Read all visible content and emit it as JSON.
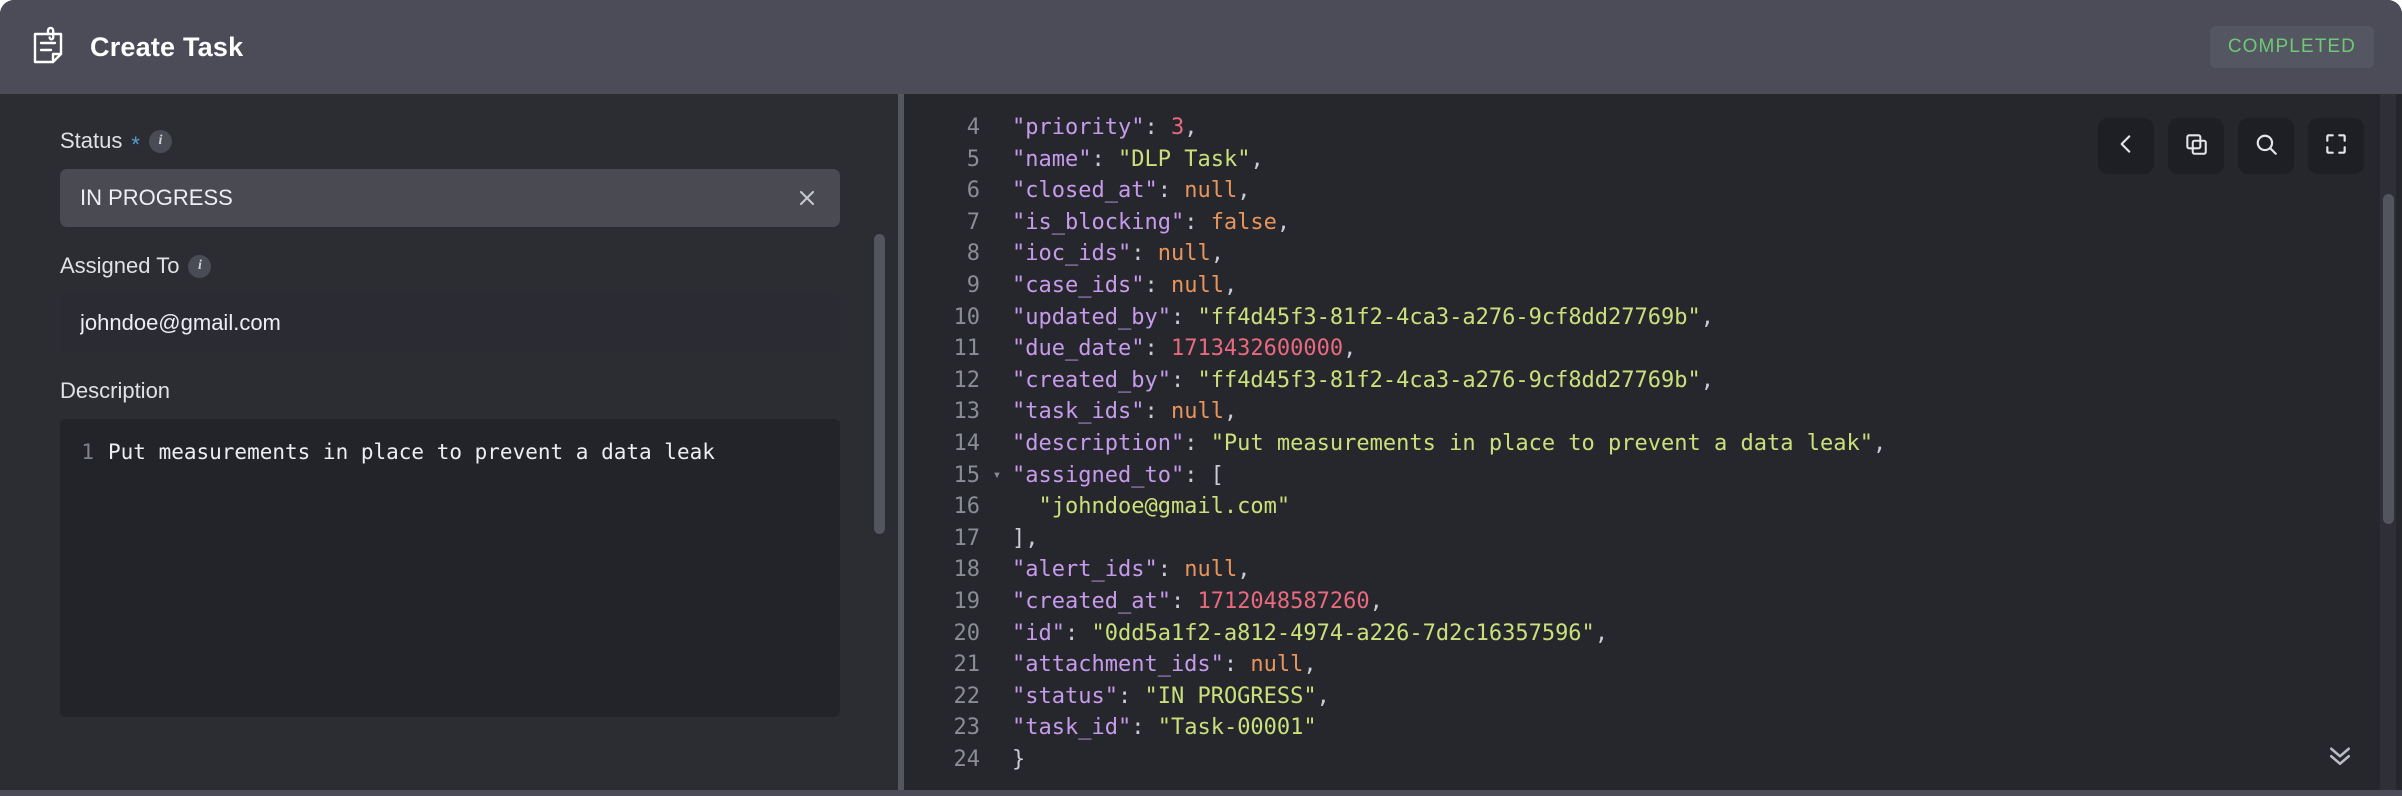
{
  "header": {
    "icon": "task-note-icon",
    "title": "Create Task",
    "status_badge": "COMPLETED",
    "badge_color": "#6ec877",
    "background": "#4b4c57"
  },
  "form": {
    "status_field": {
      "label": "Status",
      "required_marker": "*",
      "info_icon": "i",
      "value": "IN PROGRESS",
      "clear_icon": "✕"
    },
    "assigned_field": {
      "label": "Assigned To",
      "info_icon": "i",
      "value": "johndoe@gmail.com"
    },
    "description_field": {
      "label": "Description",
      "line_number": "1",
      "value": "Put measurements in place to prevent a data leak"
    }
  },
  "code_panel": {
    "toolbar": [
      {
        "name": "back-button",
        "icon": "chevron-left-icon"
      },
      {
        "name": "copy-button",
        "icon": "copy-icon"
      },
      {
        "name": "search-button",
        "icon": "search-icon"
      },
      {
        "name": "fullscreen-button",
        "icon": "fullscreen-icon"
      }
    ],
    "scroll_bottom_icon": "chevron-double-down-icon",
    "lines": [
      {
        "n": "4",
        "fold": "",
        "tokens": [
          {
            "t": "\"priority\"",
            "c": "tk-key"
          },
          {
            "t": ": ",
            "c": "tk-pun"
          },
          {
            "t": "3",
            "c": "tk-num"
          },
          {
            "t": ",",
            "c": "tk-pun"
          }
        ]
      },
      {
        "n": "5",
        "fold": "",
        "tokens": [
          {
            "t": "\"name\"",
            "c": "tk-key"
          },
          {
            "t": ": ",
            "c": "tk-pun"
          },
          {
            "t": "\"DLP Task\"",
            "c": "tk-str"
          },
          {
            "t": ",",
            "c": "tk-pun"
          }
        ]
      },
      {
        "n": "6",
        "fold": "",
        "tokens": [
          {
            "t": "\"closed_at\"",
            "c": "tk-key"
          },
          {
            "t": ": ",
            "c": "tk-pun"
          },
          {
            "t": "null",
            "c": "tk-lit"
          },
          {
            "t": ",",
            "c": "tk-pun"
          }
        ]
      },
      {
        "n": "7",
        "fold": "",
        "tokens": [
          {
            "t": "\"is_blocking\"",
            "c": "tk-key"
          },
          {
            "t": ": ",
            "c": "tk-pun"
          },
          {
            "t": "false",
            "c": "tk-lit"
          },
          {
            "t": ",",
            "c": "tk-pun"
          }
        ]
      },
      {
        "n": "8",
        "fold": "",
        "tokens": [
          {
            "t": "\"ioc_ids\"",
            "c": "tk-key"
          },
          {
            "t": ": ",
            "c": "tk-pun"
          },
          {
            "t": "null",
            "c": "tk-lit"
          },
          {
            "t": ",",
            "c": "tk-pun"
          }
        ]
      },
      {
        "n": "9",
        "fold": "",
        "tokens": [
          {
            "t": "\"case_ids\"",
            "c": "tk-key"
          },
          {
            "t": ": ",
            "c": "tk-pun"
          },
          {
            "t": "null",
            "c": "tk-lit"
          },
          {
            "t": ",",
            "c": "tk-pun"
          }
        ]
      },
      {
        "n": "10",
        "fold": "",
        "tokens": [
          {
            "t": "\"updated_by\"",
            "c": "tk-key"
          },
          {
            "t": ": ",
            "c": "tk-pun"
          },
          {
            "t": "\"ff4d45f3-81f2-4ca3-a276-9cf8dd27769b\"",
            "c": "tk-str"
          },
          {
            "t": ",",
            "c": "tk-pun"
          }
        ]
      },
      {
        "n": "11",
        "fold": "",
        "tokens": [
          {
            "t": "\"due_date\"",
            "c": "tk-key"
          },
          {
            "t": ": ",
            "c": "tk-pun"
          },
          {
            "t": "1713432600000",
            "c": "tk-num"
          },
          {
            "t": ",",
            "c": "tk-pun"
          }
        ]
      },
      {
        "n": "12",
        "fold": "",
        "tokens": [
          {
            "t": "\"created_by\"",
            "c": "tk-key"
          },
          {
            "t": ": ",
            "c": "tk-pun"
          },
          {
            "t": "\"ff4d45f3-81f2-4ca3-a276-9cf8dd27769b\"",
            "c": "tk-str"
          },
          {
            "t": ",",
            "c": "tk-pun"
          }
        ]
      },
      {
        "n": "13",
        "fold": "",
        "tokens": [
          {
            "t": "\"task_ids\"",
            "c": "tk-key"
          },
          {
            "t": ": ",
            "c": "tk-pun"
          },
          {
            "t": "null",
            "c": "tk-lit"
          },
          {
            "t": ",",
            "c": "tk-pun"
          }
        ]
      },
      {
        "n": "14",
        "fold": "",
        "tokens": [
          {
            "t": "\"description\"",
            "c": "tk-key"
          },
          {
            "t": ": ",
            "c": "tk-pun"
          },
          {
            "t": "\"Put measurements in place to prevent a data leak\"",
            "c": "tk-str"
          },
          {
            "t": ",",
            "c": "tk-pun"
          }
        ]
      },
      {
        "n": "15",
        "fold": "▾",
        "tokens": [
          {
            "t": "\"assigned_to\"",
            "c": "tk-key"
          },
          {
            "t": ": [",
            "c": "tk-pun"
          }
        ]
      },
      {
        "n": "16",
        "fold": "",
        "tokens": [
          {
            "t": "  \"johndoe@gmail.com\"",
            "c": "tk-str"
          }
        ]
      },
      {
        "n": "17",
        "fold": "",
        "tokens": [
          {
            "t": "],",
            "c": "tk-pun"
          }
        ]
      },
      {
        "n": "18",
        "fold": "",
        "tokens": [
          {
            "t": "\"alert_ids\"",
            "c": "tk-key"
          },
          {
            "t": ": ",
            "c": "tk-pun"
          },
          {
            "t": "null",
            "c": "tk-lit"
          },
          {
            "t": ",",
            "c": "tk-pun"
          }
        ]
      },
      {
        "n": "19",
        "fold": "",
        "tokens": [
          {
            "t": "\"created_at\"",
            "c": "tk-key"
          },
          {
            "t": ": ",
            "c": "tk-pun"
          },
          {
            "t": "1712048587260",
            "c": "tk-num"
          },
          {
            "t": ",",
            "c": "tk-pun"
          }
        ]
      },
      {
        "n": "20",
        "fold": "",
        "tokens": [
          {
            "t": "\"id\"",
            "c": "tk-key"
          },
          {
            "t": ": ",
            "c": "tk-pun"
          },
          {
            "t": "\"0dd5a1f2-a812-4974-a226-7d2c16357596\"",
            "c": "tk-str"
          },
          {
            "t": ",",
            "c": "tk-pun"
          }
        ]
      },
      {
        "n": "21",
        "fold": "",
        "tokens": [
          {
            "t": "\"attachment_ids\"",
            "c": "tk-key"
          },
          {
            "t": ": ",
            "c": "tk-pun"
          },
          {
            "t": "null",
            "c": "tk-lit"
          },
          {
            "t": ",",
            "c": "tk-pun"
          }
        ]
      },
      {
        "n": "22",
        "fold": "",
        "tokens": [
          {
            "t": "\"status\"",
            "c": "tk-key"
          },
          {
            "t": ": ",
            "c": "tk-pun"
          },
          {
            "t": "\"IN PROGRESS\"",
            "c": "tk-str"
          },
          {
            "t": ",",
            "c": "tk-pun"
          }
        ]
      },
      {
        "n": "23",
        "fold": "",
        "tokens": [
          {
            "t": "\"task_id\"",
            "c": "tk-key"
          },
          {
            "t": ": ",
            "c": "tk-pun"
          },
          {
            "t": "\"Task-00001\"",
            "c": "tk-str"
          }
        ]
      },
      {
        "n": "24",
        "fold": "",
        "tokens": [
          {
            "t": "}",
            "c": "tk-pun"
          }
        ]
      }
    ]
  }
}
